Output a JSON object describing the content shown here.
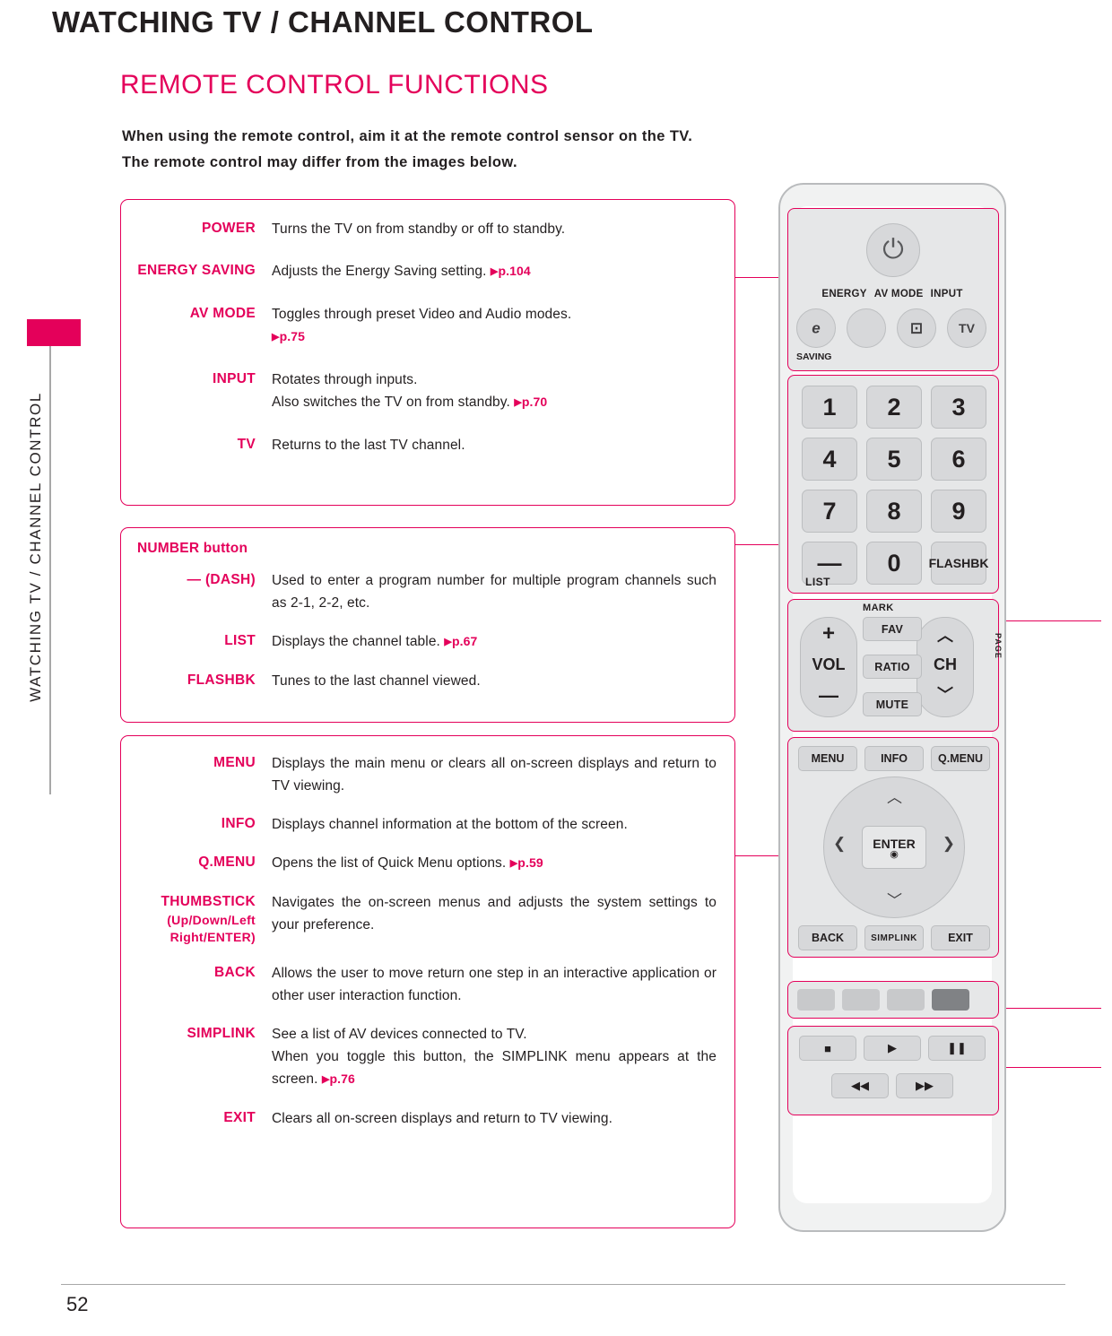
{
  "header": {
    "title": "WATCHING TV / CHANNEL CONTROL",
    "side_tab_text": "WATCHING TV / CHANNEL CONTROL"
  },
  "section": {
    "title": "REMOTE CONTROL FUNCTIONS",
    "intro_line1": "When using the remote control, aim it at the remote control sensor on the TV.",
    "intro_line2": "The remote control may differ from the images below."
  },
  "groups": [
    {
      "id": "group-power",
      "rows": [
        {
          "label": "POWER",
          "text": "Turns the TV on from standby or off to standby.",
          "ref": ""
        },
        {
          "label": "ENERGY SAVING",
          "text": "Adjusts the Energy Saving setting.",
          "ref": "p.104"
        },
        {
          "label": "AV MODE",
          "text": "Toggles through preset Video and Audio modes.",
          "ref": "p.75"
        },
        {
          "label": "INPUT",
          "text": "Rotates through inputs.",
          "text2": "Also switches the TV on from standby.",
          "ref": "p.70"
        },
        {
          "label": "TV",
          "text": "Returns to the last TV channel.",
          "ref": ""
        }
      ]
    },
    {
      "id": "group-number",
      "group_title": "NUMBER button",
      "rows": [
        {
          "label": "— (DASH)",
          "text": "Used to enter a program number for multiple program channels such as 2-1, 2-2, etc.",
          "ref": ""
        },
        {
          "label": "LIST",
          "text": "Displays the channel table.",
          "ref": "p.67"
        },
        {
          "label": "FLASHBK",
          "text": "Tunes to the last channel viewed.",
          "ref": ""
        }
      ]
    },
    {
      "id": "group-menu",
      "rows": [
        {
          "label": "MENU",
          "text": "Displays the main menu or clears all on-screen displays and return to TV viewing.",
          "ref": ""
        },
        {
          "label": "INFO",
          "text": "Displays channel information at the bottom of the screen.",
          "ref": ""
        },
        {
          "label": "Q.MENU",
          "text": "Opens the list of Quick Menu options.",
          "ref": "p.59"
        },
        {
          "label": "THUMBSTICK",
          "label_sub1": "(Up/Down/Left",
          "label_sub2": "Right/ENTER)",
          "text": "Navigates the on-screen menus and adjusts the system settings to your preference.",
          "ref": ""
        },
        {
          "label": "BACK",
          "text": "Allows the user to move return one step in an interactive application or other user interaction function.",
          "ref": ""
        },
        {
          "label": "SIMPLINK",
          "text": "See a list of AV devices connected to TV.",
          "text2": "When you toggle this button, the SIMPLINK menu appears at the screen.",
          "ref": "p.76"
        },
        {
          "label": "EXIT",
          "text": "Clears all on-screen displays and return to TV viewing.",
          "ref": ""
        }
      ]
    }
  ],
  "remote": {
    "power_icon": "power-icon",
    "top_labels": {
      "energy": "ENERGY",
      "avmode": "AV MODE",
      "input": "INPUT",
      "saving": "SAVING"
    },
    "top_buttons": {
      "energy_glyph": "e",
      "av_mode_glyph": "",
      "input_glyph": "⊡",
      "tv_label": "TV"
    },
    "numbers": [
      "1",
      "2",
      "3",
      "4",
      "5",
      "6",
      "7",
      "8",
      "9",
      "—",
      "0",
      "FLASHBK"
    ],
    "list_label": "LIST",
    "mark_label": "MARK",
    "page_label": "PAGE",
    "vol_label": "VOL",
    "ch_label": "CH",
    "vol_plus": "+",
    "vol_minus": "—",
    "side_buttons": [
      "FAV",
      "RATIO",
      "MUTE"
    ],
    "menu_buttons": {
      "menu": "MENU",
      "info": "INFO",
      "qmenu": "Q.MENU",
      "enter": "ENTER",
      "back": "BACK",
      "simplink": "SIMPLINK",
      "exit": "EXIT"
    },
    "color_keys": [
      "#c8c9cb",
      "#c8c9cb",
      "#c8c9cb",
      "#808285"
    ],
    "playback_keys": [
      "■",
      "▶",
      "❚❚",
      "◀◀",
      "▶▶"
    ]
  },
  "footer": {
    "page_number": "52"
  }
}
